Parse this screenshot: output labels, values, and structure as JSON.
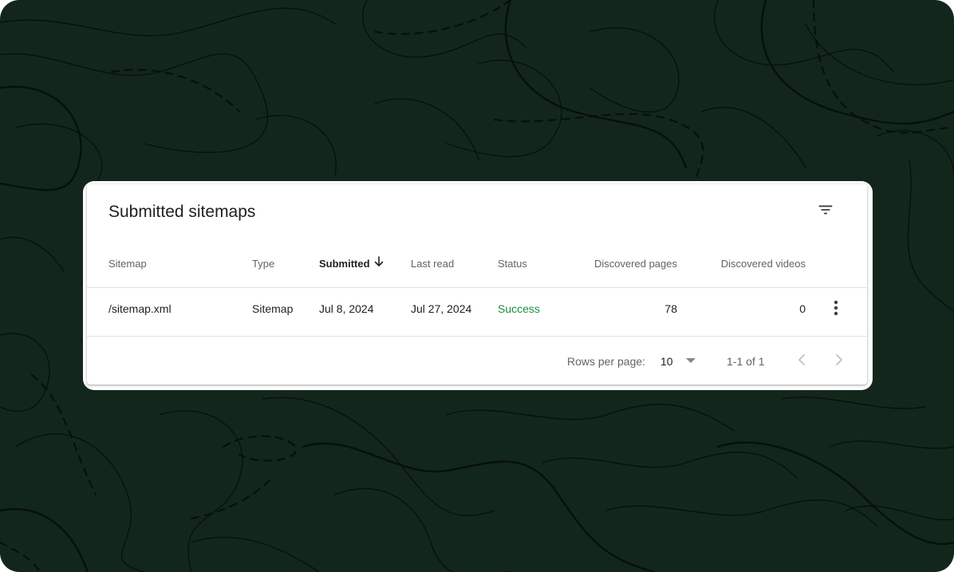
{
  "colors": {
    "background": "#13261c",
    "contour": "#060f0a",
    "card": "#ffffff",
    "success": "#1e8e3e",
    "text_primary": "#202124",
    "text_secondary": "#5f6368",
    "icon_disabled": "#bdc1c6"
  },
  "card": {
    "title": "Submitted sitemaps",
    "filter_icon": "filter-list-icon"
  },
  "table": {
    "columns": [
      {
        "label": "Sitemap"
      },
      {
        "label": "Type"
      },
      {
        "label": "Submitted",
        "sorted": "descending",
        "sort_icon": "arrow-downward-icon"
      },
      {
        "label": "Last read"
      },
      {
        "label": "Status"
      },
      {
        "label": "Discovered pages"
      },
      {
        "label": "Discovered videos"
      }
    ],
    "rows": [
      {
        "sitemap": "/sitemap.xml",
        "type": "Sitemap",
        "submitted": "Jul 8, 2024",
        "last_read": "Jul 27, 2024",
        "status": "Success",
        "discovered_pages": "78",
        "discovered_videos": "0",
        "menu_icon": "more-vert-icon"
      }
    ]
  },
  "pagination": {
    "rows_per_page_label": "Rows per page:",
    "rows_per_page_value": "10",
    "range": "1-1 of 1",
    "prev_icon": "chevron-left-icon",
    "next_icon": "chevron-right-icon"
  }
}
